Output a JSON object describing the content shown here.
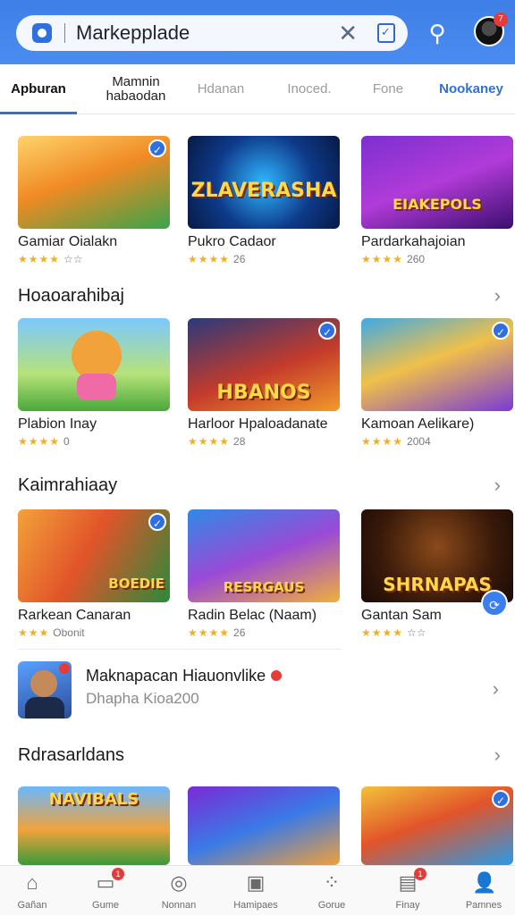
{
  "search": {
    "value": "Markepplade",
    "clear_icon": "close-icon",
    "calendar_icon": "calendar-check-icon"
  },
  "header": {
    "notifications_icon": "bell-icon",
    "avatar_badge": "7"
  },
  "tabs": [
    {
      "label": "Apburan"
    },
    {
      "label": "Mamnin\nhabaodan"
    },
    {
      "label": "Hdanan"
    },
    {
      "label": "Inoced."
    },
    {
      "label": "Fone"
    },
    {
      "label": "Nookaney"
    }
  ],
  "row1": [
    {
      "title": "Gamiar Oialakn",
      "rating_text": "☆☆",
      "stars": "★★★★",
      "art": ""
    },
    {
      "title": "Pukro Cadaor",
      "rating_text": "26",
      "stars": "★★★★",
      "art": "ZLAVERASHA"
    },
    {
      "title": "Pardarkahajoian",
      "rating_text": "260",
      "stars": "★★★★",
      "art": "EIAKEPOLS"
    }
  ],
  "section1": {
    "title": "Hoaoarahibaj"
  },
  "row2": [
    {
      "title": "Plabion Inay",
      "rating_text": "0",
      "stars": "★★★★",
      "art": ""
    },
    {
      "title": "Harloor Hpaloadanate",
      "rating_text": "28",
      "stars": "★★★★",
      "art": "HBANOS"
    },
    {
      "title": "Kamoan Aelikare)",
      "rating_text": "2004",
      "stars": "★★★★",
      "art": ""
    }
  ],
  "section2": {
    "title": "Kaimrahiaay"
  },
  "row3": [
    {
      "title": "Rarkean Canaran",
      "rating_text": "Obonit",
      "stars": "★★★",
      "art": "BOEDIE"
    },
    {
      "title": "Radin Belac (Naam)",
      "rating_text": "26",
      "stars": "★★★★",
      "art": "RESRGAUS"
    },
    {
      "title": "Gantan Sam",
      "rating_text": "☆☆",
      "stars": "★★★★",
      "art": "SHRNAPAS"
    }
  ],
  "promo": {
    "title": "Maknapacan Hiauonvlike",
    "subtitle": "Dhapha Kioa200"
  },
  "section3": {
    "title": "Rdrasarldans"
  },
  "row4": [
    {
      "art": "NAVIBALS"
    },
    {
      "art": ""
    },
    {
      "art": ""
    }
  ],
  "bottom_nav": [
    {
      "label": "Gañan",
      "icon": "home-icon",
      "badge": ""
    },
    {
      "label": "Gume",
      "icon": "inbox-icon",
      "badge": "1"
    },
    {
      "label": "Nonnan",
      "icon": "chat-icon",
      "badge": ""
    },
    {
      "label": "Hamipaes",
      "icon": "gamepad-icon",
      "badge": ""
    },
    {
      "label": "Gorue",
      "icon": "grid-icon",
      "badge": ""
    },
    {
      "label": "Finay",
      "icon": "wallet-icon",
      "badge": "1"
    },
    {
      "label": "Pamnes",
      "icon": "profile-icon",
      "badge": ""
    }
  ],
  "colors": {
    "accent": "#2f6fe0",
    "header": "#4a8cf0",
    "star": "#f2b01e",
    "badge": "#e43b3b"
  }
}
